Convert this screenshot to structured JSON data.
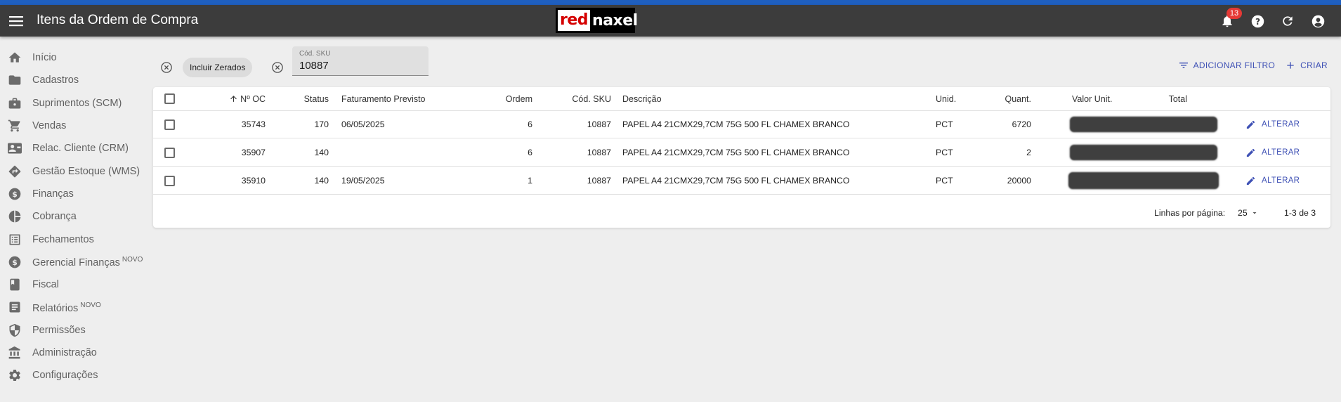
{
  "appbar": {
    "title": "Itens da Ordem de Compra",
    "logo_left": "red",
    "logo_right": "naxel",
    "notification_count": "13"
  },
  "sidebar": {
    "items": [
      {
        "label": "Início",
        "icon": "home-icon"
      },
      {
        "label": "Cadastros",
        "icon": "folder-icon"
      },
      {
        "label": "Suprimentos (SCM)",
        "icon": "briefcase-icon"
      },
      {
        "label": "Vendas",
        "icon": "cart-icon"
      },
      {
        "label": "Relac. Cliente (CRM)",
        "icon": "contact-card-icon"
      },
      {
        "label": "Gestão Estoque (WMS)",
        "icon": "directions-icon"
      },
      {
        "label": "Finanças",
        "icon": "dollar-circle-icon"
      },
      {
        "label": "Cobrança",
        "icon": "pie-chart-icon"
      },
      {
        "label": "Fechamentos",
        "icon": "list-alt-icon"
      },
      {
        "label": "Gerencial Finanças",
        "icon": "dollar-circle-icon",
        "tag": "NOVO"
      },
      {
        "label": "Fiscal",
        "icon": "book-icon"
      },
      {
        "label": "Relatórios",
        "icon": "description-icon",
        "tag": "NOVO"
      },
      {
        "label": "Permissões",
        "icon": "shield-icon"
      },
      {
        "label": "Administração",
        "icon": "bank-icon"
      },
      {
        "label": "Configurações",
        "icon": "gear-icon"
      }
    ]
  },
  "filters": {
    "chip_label": "Incluir Zerados",
    "sku_label": "Cód. SKU",
    "sku_value": "10887"
  },
  "actions": {
    "add_filter": "ADICIONAR FILTRO",
    "create": "CRIAR"
  },
  "table": {
    "columns": [
      "Nº OC",
      "Status",
      "Faturamento Previsto",
      "Ordem",
      "Cód. SKU",
      "Descrição",
      "Unid.",
      "Quant.",
      "Valor Unit.",
      "Total"
    ],
    "sorted_column": "Nº OC",
    "rows": [
      {
        "oc": "35743",
        "status": "170",
        "faturamento": "06/05/2025",
        "ordem": "6",
        "sku": "10887",
        "descricao": "PAPEL A4 21CMX29,7CM 75G 500 FL CHAMEX BRANCO",
        "unid": "PCT",
        "quant": "6720",
        "edit": "ALTERAR"
      },
      {
        "oc": "35907",
        "status": "140",
        "faturamento": "",
        "ordem": "6",
        "sku": "10887",
        "descricao": "PAPEL A4 21CMX29,7CM 75G 500 FL CHAMEX BRANCO",
        "unid": "PCT",
        "quant": "2",
        "edit": "ALTERAR"
      },
      {
        "oc": "35910",
        "status": "140",
        "faturamento": "19/05/2025",
        "ordem": "1",
        "sku": "10887",
        "descricao": "PAPEL A4 21CMX29,7CM 75G 500 FL CHAMEX BRANCO",
        "unid": "PCT",
        "quant": "20000",
        "edit": "ALTERAR"
      }
    ]
  },
  "pagination": {
    "rows_per_page_label": "Linhas por página:",
    "rows_per_page": "25",
    "range": "1-3 de 3"
  },
  "colors": {
    "appbar": "#3c3c3c",
    "top_stripe": "#1f5fbf",
    "accent": "#3f51b5",
    "badge": "#e53935"
  }
}
